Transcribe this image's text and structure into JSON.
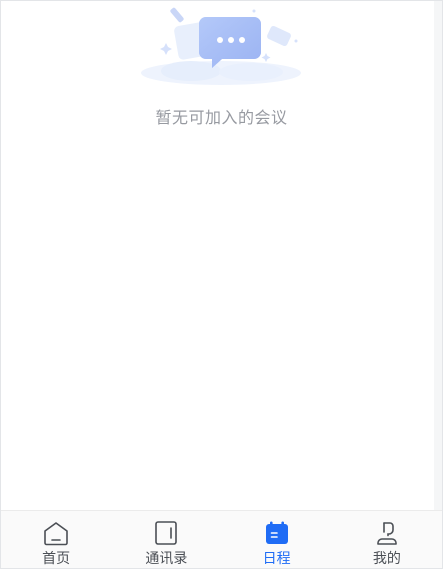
{
  "empty_state": {
    "message": "暂无可加入的会议"
  },
  "tabbar": {
    "active_color": "#1f6cf5",
    "inactive_color": "#4b4f55",
    "tabs": [
      {
        "label": "首页",
        "icon": "home-icon",
        "active": false
      },
      {
        "label": "通讯录",
        "icon": "contacts-icon",
        "active": false
      },
      {
        "label": "日程",
        "icon": "calendar-icon",
        "active": true
      },
      {
        "label": "我的",
        "icon": "profile-icon",
        "active": false
      }
    ]
  }
}
